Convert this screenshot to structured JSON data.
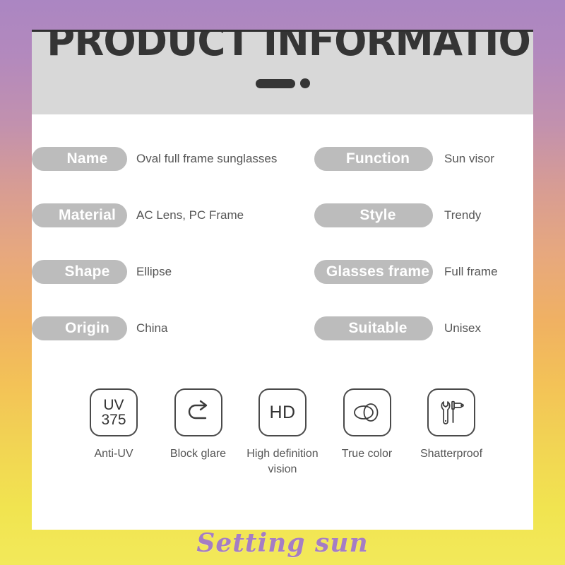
{
  "page": {
    "background_top_color": "#ab86c2",
    "background_mid_color": "#e7a87e",
    "background_bottom_color": "#f2e95a"
  },
  "header": {
    "title": "PRODUCT INFORMATION",
    "accent_color": "#353535",
    "band_color": "#d8d8d8",
    "decoration": {
      "dash_name": "dash-ornament",
      "dot_name": "dot-ornament"
    }
  },
  "specs": {
    "pill_color": "#bcbcbc",
    "value_color": "#555555",
    "rows": [
      {
        "left": {
          "label": "Name",
          "value": "Oval full frame sunglasses"
        },
        "right": {
          "label": "Function",
          "value": "Sun visor"
        }
      },
      {
        "left": {
          "label": "Material",
          "value": "AC Lens, PC Frame"
        },
        "right": {
          "label": "Style",
          "value": "Trendy"
        }
      },
      {
        "left": {
          "label": "Shape",
          "value": "Ellipse"
        },
        "right": {
          "label": "Glasses frame",
          "value": "Full frame"
        }
      },
      {
        "left": {
          "label": "Origin",
          "value": "China"
        },
        "right": {
          "label": "Suitable",
          "value": "Unisex"
        }
      }
    ]
  },
  "features": [
    {
      "icon": "uv-375-icon",
      "icon_line1": "UV",
      "icon_line2": "375",
      "label": "Anti-UV"
    },
    {
      "icon": "u-turn-arrow-icon",
      "label": "Block glare"
    },
    {
      "icon": "hd-icon",
      "icon_text": "HD",
      "label": "High definition vision"
    },
    {
      "icon": "overlapping-ellipses-icon",
      "label": "True color"
    },
    {
      "icon": "wrench-hammer-icon",
      "label": "Shatterproof"
    }
  ],
  "watermark": {
    "text": "Setting sun",
    "color": "#9b6fd4"
  }
}
